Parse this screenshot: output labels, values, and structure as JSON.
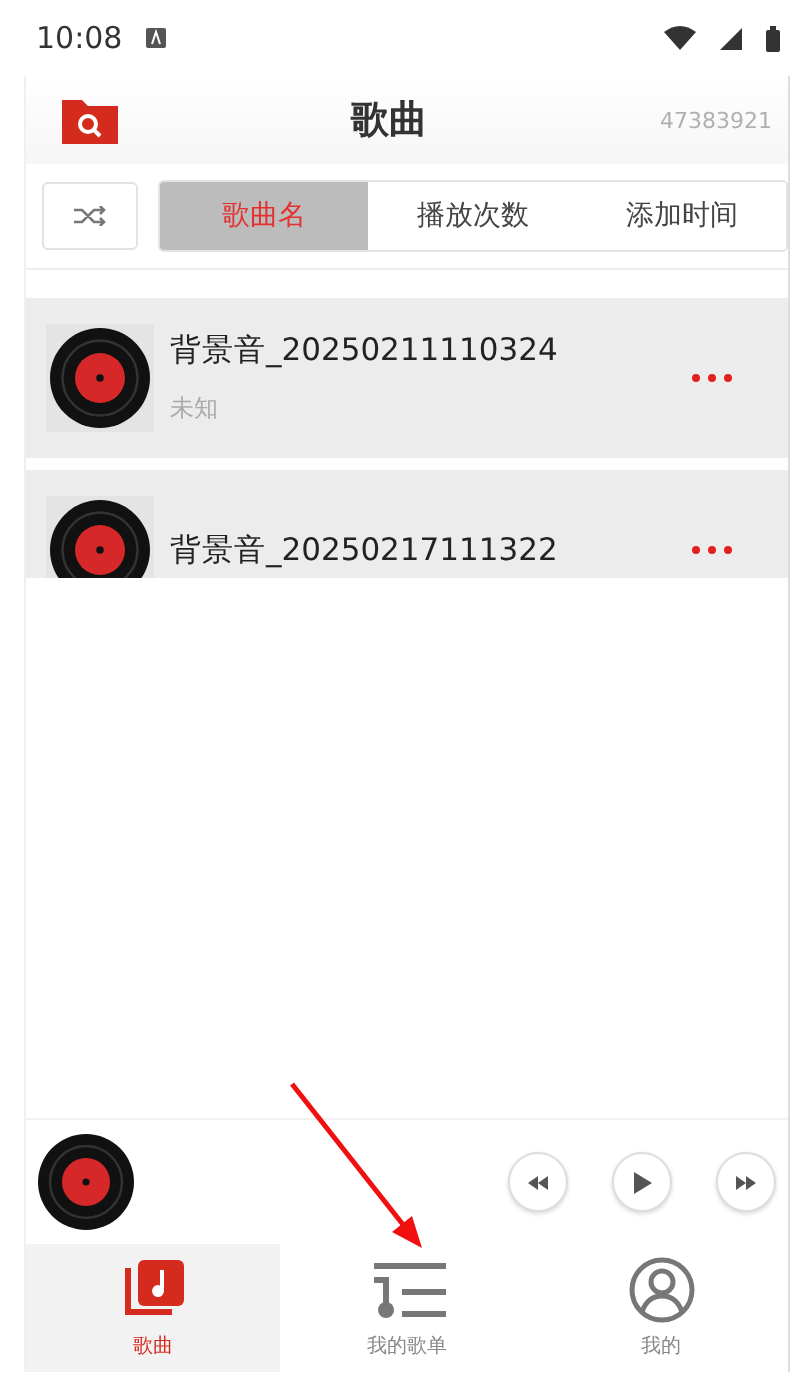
{
  "status_bar": {
    "time": "10:08"
  },
  "header": {
    "title": "歌曲",
    "code": "47383921"
  },
  "sort_tabs": [
    {
      "label": "歌曲名",
      "selected": true
    },
    {
      "label": "播放次数",
      "selected": false
    },
    {
      "label": "添加时间",
      "selected": false
    }
  ],
  "songs": [
    {
      "title": "背景音_20250211110324",
      "artist": "未知"
    },
    {
      "title": "背景音_20250217111322"
    }
  ],
  "nav": [
    {
      "label": "歌曲",
      "kind": "songs",
      "selected": true
    },
    {
      "label": "我的歌单",
      "kind": "playlists",
      "selected": false
    },
    {
      "label": "我的",
      "kind": "profile",
      "selected": false
    }
  ]
}
